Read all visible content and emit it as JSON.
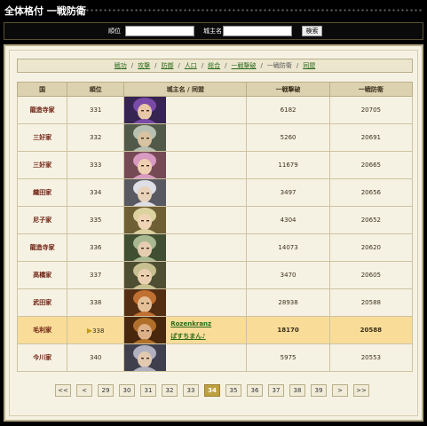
{
  "header": {
    "title": "全体格付 一戦防衛"
  },
  "search": {
    "rank_label": "順位",
    "lord_label": "城主名",
    "rank_value": "",
    "lord_value": "",
    "button_label": "検索"
  },
  "tabs": [
    {
      "label": "戦功",
      "current": false
    },
    {
      "label": "攻撃",
      "current": false
    },
    {
      "label": "防御",
      "current": false
    },
    {
      "label": "人口",
      "current": false
    },
    {
      "label": "総合",
      "current": false
    },
    {
      "label": "一戦撃破",
      "current": false
    },
    {
      "label": "一戦防衛",
      "current": true
    },
    {
      "label": "同盟",
      "current": false
    }
  ],
  "table": {
    "headers": [
      "国",
      "順位",
      "城主名 / 同盟",
      "一戦撃破",
      "一戦防衛"
    ],
    "rows": [
      {
        "clan": "龍造寺家",
        "rank": "331",
        "lord": "",
        "alliance": "",
        "kill": "6182",
        "defense": "20705"
      },
      {
        "clan": "三好家",
        "rank": "332",
        "lord": "",
        "alliance": "",
        "kill": "5260",
        "defense": "20691"
      },
      {
        "clan": "三好家",
        "rank": "333",
        "lord": "",
        "alliance": "",
        "kill": "11679",
        "defense": "20665"
      },
      {
        "clan": "織田家",
        "rank": "334",
        "lord": "",
        "alliance": "",
        "kill": "3497",
        "defense": "20656"
      },
      {
        "clan": "尼子家",
        "rank": "335",
        "lord": "",
        "alliance": "",
        "kill": "4304",
        "defense": "20652"
      },
      {
        "clan": "龍造寺家",
        "rank": "336",
        "lord": "",
        "alliance": "",
        "kill": "14073",
        "defense": "20620"
      },
      {
        "clan": "高橋家",
        "rank": "337",
        "lord": "",
        "alliance": "",
        "kill": "3470",
        "defense": "20605"
      },
      {
        "clan": "武田家",
        "rank": "338",
        "lord": "",
        "alliance": "",
        "kill": "28938",
        "defense": "20588"
      },
      {
        "clan": "毛利家",
        "rank": "338",
        "lord": "Rozenkranz",
        "alliance": "ぱすちまん♪",
        "kill": "18170",
        "defense": "20588",
        "highlight": true
      },
      {
        "clan": "今川家",
        "rank": "340",
        "lord": "",
        "alliance": "",
        "kill": "5975",
        "defense": "20553"
      }
    ]
  },
  "pager": {
    "first": "<<",
    "prev": "<",
    "pages": [
      "29",
      "30",
      "31",
      "32",
      "33",
      "34",
      "35",
      "36",
      "37",
      "38",
      "39"
    ],
    "current": "34",
    "next": ">",
    "last": ">>"
  },
  "colors": {
    "accent_gold": "#bfa040",
    "highlight_row": "#f8dc98",
    "link_green": "#2a6a1a",
    "clan_red": "#6b1b0c"
  }
}
